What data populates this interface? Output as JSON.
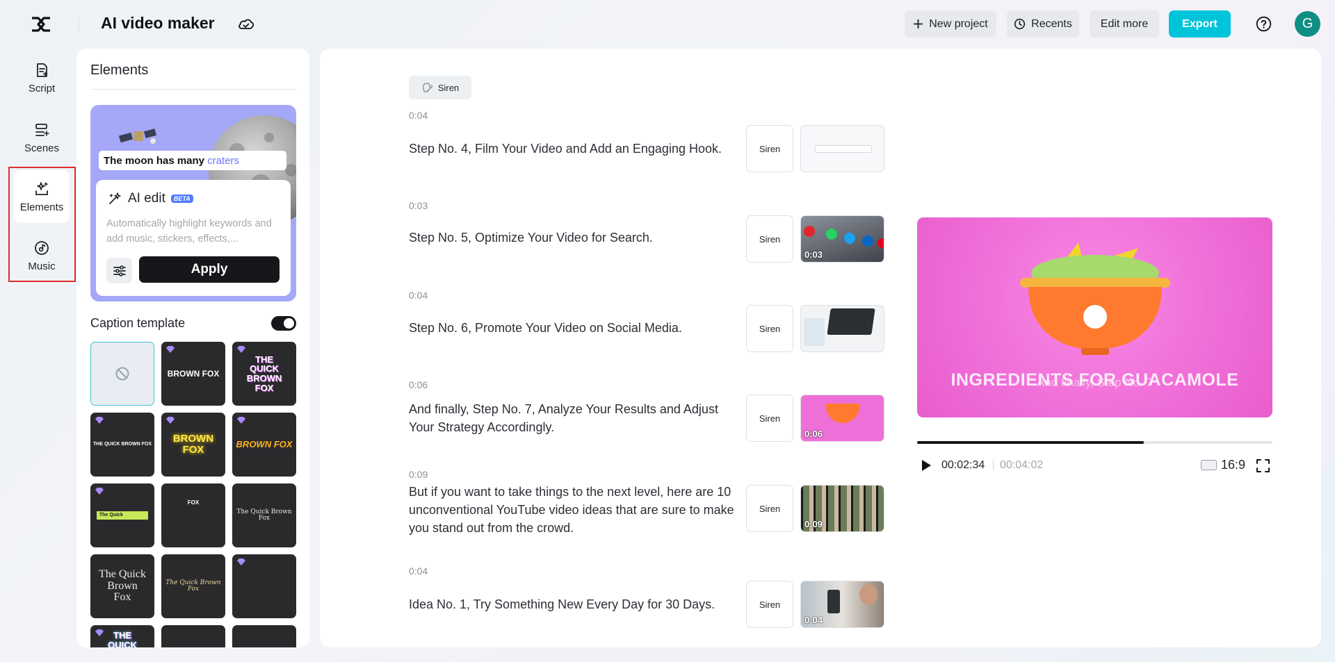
{
  "header": {
    "app_title": "AI video maker",
    "buttons": {
      "new_project": "New project",
      "recents": "Recents",
      "edit_more": "Edit more",
      "export": "Export"
    },
    "avatar_initial": "G",
    "accent_color": "#00c4d9"
  },
  "sidebar": {
    "items": [
      {
        "label": "Script",
        "icon": "script-icon"
      },
      {
        "label": "Scenes",
        "icon": "scenes-icon"
      },
      {
        "label": "Elements",
        "icon": "elements-icon",
        "active": true
      },
      {
        "label": "Music",
        "icon": "music-icon"
      }
    ]
  },
  "panel": {
    "title": "Elements",
    "preview_caption": {
      "prefix": "The moon has many",
      "highlight": "craters"
    },
    "ai_edit": {
      "title": "AI edit",
      "badge": "BETA",
      "description": "Automatically highlight keywords and add music, stickers, effects,...",
      "apply_label": "Apply"
    },
    "caption_template": {
      "title": "Caption template",
      "enabled": true,
      "templates": [
        {
          "text": "",
          "premium": false,
          "kind": "none"
        },
        {
          "text": "BROWN FOX",
          "premium": true
        },
        {
          "text": "THE QUICK BROWN FOX",
          "premium": true
        },
        {
          "text": "THE QUICK BROWN FOX",
          "premium": true
        },
        {
          "text": "BROWN FOX",
          "premium": true
        },
        {
          "text": "BROWN FOX",
          "premium": true
        },
        {
          "text": "The Quick",
          "premium": true
        },
        {
          "text": "FOX",
          "premium": false
        },
        {
          "text": "The Quick Brown Fox",
          "premium": false
        },
        {
          "text": "The Quick Brown Fox",
          "premium": false
        },
        {
          "text": "The Quick Brown Fox",
          "premium": false
        },
        {
          "text": "",
          "premium": true
        },
        {
          "text": "THE QUICK BROWN",
          "premium": true
        },
        {
          "text": "",
          "premium": false
        },
        {
          "text": "",
          "premium": false
        }
      ]
    }
  },
  "script": {
    "voice_chip": "Siren",
    "scenes": [
      {
        "time": "0:04",
        "text": "Step No. 4, Film Your Video and Add an Engaging Hook.",
        "voice": "Siren",
        "thumb_duration": ""
      },
      {
        "time": "0:03",
        "text": "Step No. 5, Optimize Your Video for Search.",
        "voice": "Siren",
        "thumb_duration": "0:03"
      },
      {
        "time": "0:04",
        "text": "Step No. 6, Promote Your Video on Social Media.",
        "voice": "Siren",
        "thumb_duration": ""
      },
      {
        "time": "0:06",
        "text": "And finally, Step No. 7, Analyze Your Results and Adjust Your Strategy Accordingly.",
        "voice": "Siren",
        "thumb_duration": "0:06"
      },
      {
        "time": "0:09",
        "text": "But if you want to take things to the next level, here are 10 unconventional YouTube video ideas that are sure to make you stand out from the crowd.",
        "voice": "Siren",
        "thumb_duration": "0:09"
      },
      {
        "time": "0:04",
        "text": "Idea No. 1, Try Something New Every Day for 30 Days.",
        "voice": "Siren",
        "thumb_duration": "0:04"
      }
    ]
  },
  "preview": {
    "title": "INGREDIENTS FOR GUACAMOLE",
    "subtitle": "And finally, Step No. 7",
    "current_time": "00:02:34",
    "total_time": "00:04:02",
    "progress_fraction": 0.637,
    "aspect_ratio": "16:9"
  }
}
